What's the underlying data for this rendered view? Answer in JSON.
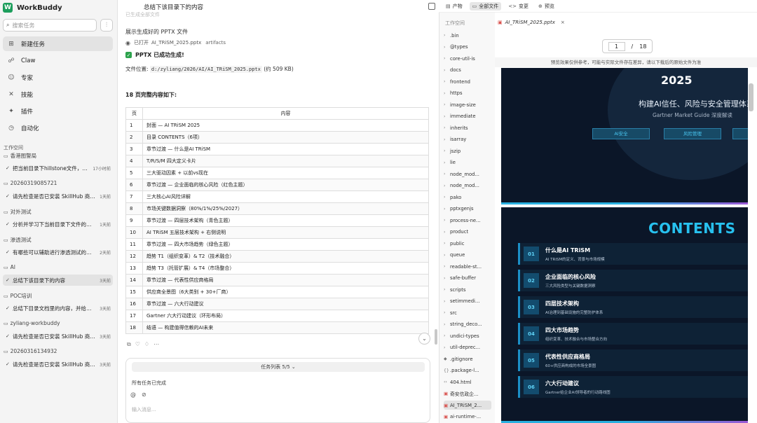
{
  "app": {
    "name": "WorkBuddy",
    "logo_letter": "W"
  },
  "search": {
    "placeholder": "搜索任务"
  },
  "nav": [
    {
      "label": "新建任务",
      "icon": "new-task-icon",
      "glyph": "⊞"
    },
    {
      "label": "Claw",
      "icon": "claw-icon",
      "glyph": "☍"
    },
    {
      "label": "专家",
      "icon": "expert-icon",
      "glyph": "☺"
    },
    {
      "label": "技能",
      "icon": "skill-icon",
      "glyph": "✕"
    },
    {
      "label": "插件",
      "icon": "plugin-icon",
      "glyph": "✦"
    },
    {
      "label": "自动化",
      "icon": "clock-icon",
      "glyph": "◷"
    }
  ],
  "workspace_label": "工作空间",
  "groups": [
    {
      "name": "香港图警局",
      "task": "把当前目录下hillstone文件，…",
      "time": "17小时前"
    },
    {
      "name": "20260319085721",
      "task": "请先检查是否已安装 SkillHub 商…",
      "time": "1天前"
    },
    {
      "name": "对外测试",
      "task": "分析并学习下当前目录下文件的…",
      "time": "1天前"
    },
    {
      "name": "渗透测试",
      "task": "有哪些可以辅助进行渗透测试的…",
      "time": "2天前"
    },
    {
      "name": "AI",
      "task": "总结下该目录下的内容",
      "time": "3天前"
    },
    {
      "name": "POC培训",
      "task": "总结下目录文档里的内容，并给…",
      "time": "3天前"
    },
    {
      "name": "zyliang-workbuddy",
      "task": "请先检查是否已安装 SkillHub 商…",
      "time": "3天前"
    },
    {
      "name": "20260316134932",
      "task": "请先检查是否已安装 SkillHub 商…",
      "time": "3天前"
    }
  ],
  "chat": {
    "title": "总结下该目录下的内容",
    "top_fragment": "已生成全部文件",
    "ppt_heading": "展示生成好的 PPTX 文件",
    "opened_label": "已打开",
    "opened_file": "AI_TRiSM_2025.pptx",
    "opened_dir": "artifacts",
    "success": "PPTX 已成功生成!",
    "file_loc_label": "文件位置:",
    "file_loc_path": "d:/zyliang/2026/AI/AI_TRiSM_2025.pptx",
    "file_loc_size": "(约 509 KB)",
    "pages_intro": "18 页完整内容如下:",
    "table_headers": [
      "页",
      "内容"
    ],
    "table_rows": [
      [
        "1",
        "封面 — AI TRiSM 2025"
      ],
      [
        "2",
        "目录 CONTENTS（6项）"
      ],
      [
        "3",
        "章节过渡 — 什么是AI TRiSM"
      ],
      [
        "4",
        "T/R/S/M 四大定义卡片"
      ],
      [
        "5",
        "三大驱动因素 + 以前vs现在"
      ],
      [
        "6",
        "章节过渡 — 企业面临的核心风险（红色主题）"
      ],
      [
        "7",
        "三大核心AI风险详解"
      ],
      [
        "8",
        "市场关键数据洞察（80%/1%/25%/2027）"
      ],
      [
        "9",
        "章节过渡 — 四层技术架构（青色主题）"
      ],
      [
        "10",
        "AI TRiSM 五层技术架构 + 右侧说明"
      ],
      [
        "11",
        "章节过渡 — 四大市场趋势（绿色主题）"
      ],
      [
        "12",
        "趋势 T1（组织变革）& T2（技术融合）"
      ],
      [
        "13",
        "趋势 T3（托管扩展）& T4（市场整合）"
      ],
      [
        "14",
        "章节过渡 — 代表性供应商格局"
      ],
      [
        "15",
        "供应商全景图（6大类别 + 30+厂商）"
      ],
      [
        "16",
        "章节过渡 — 六大行动建议"
      ],
      [
        "17",
        "Gartner 六大行动建议（环形布局）"
      ],
      [
        "18",
        "结语 — 构建值得信赖的AI未来"
      ]
    ],
    "task_list": "任务列表 5/5",
    "tasks_done": "所有任务已完成",
    "input_placeholder": "输入消息..."
  },
  "top_tabs": [
    {
      "label": "产物",
      "icon": "artifact-icon",
      "glyph": "▤"
    },
    {
      "label": "全部文件",
      "icon": "folder-icon",
      "glyph": "▭"
    },
    {
      "label": "变更",
      "icon": "code-icon",
      "glyph": "<>"
    },
    {
      "label": "预览",
      "icon": "globe-icon",
      "glyph": "⊕"
    }
  ],
  "file_tree": {
    "title": "工作空间",
    "items": [
      ".bin",
      "@types",
      "core-util-is",
      "docs",
      "frontend",
      "https",
      "image-size",
      "immediate",
      "inherits",
      "isarray",
      "jszip",
      "lie",
      "node_mod...",
      "node_mod...",
      "pako",
      "pptxgenjs",
      "process-ne...",
      "product",
      "public",
      "queue",
      "readable-st...",
      "safe-buffer",
      "scripts",
      "setimmedi...",
      "src",
      "string_deco...",
      "undici-types",
      "util-deprec...",
      ".gitignore",
      ".package-l...",
      "404.html",
      "奇安信政企...",
      "AI_TRiSM_2...",
      "ai-runtime-..."
    ]
  },
  "preview": {
    "file_tab": "AI_TRiSM_2025.pptx",
    "page_current": "1",
    "page_sep": "/",
    "page_total": "18",
    "note": "预览效果仅供参考，可能与实际文件存在差异，请以下载后的原始文件为准",
    "slide1": {
      "year": "2025",
      "title": "构建AI信任、风险与安全管理体系",
      "subtitle": "Gartner Market Guide 深度解读",
      "buttons": [
        "AI安全",
        "风险管理"
      ]
    },
    "slide2": {
      "title": "CONTENTS",
      "items": [
        {
          "num": "01",
          "title": "什么是AI TRiSM",
          "sub": "AI TRiSM的定义、背景与市场规模"
        },
        {
          "num": "02",
          "title": "企业面临的核心风险",
          "sub": "三大风险类型与关键数据洞察"
        },
        {
          "num": "03",
          "title": "四层技术架构",
          "sub": "AI治理到基础设施的完整防护体系"
        },
        {
          "num": "04",
          "title": "四大市场趋势",
          "sub": "组织变革、技术融合与市场整合方向"
        },
        {
          "num": "05",
          "title": "代表性供应商格局",
          "sub": "60+供应商构成的市场全景图"
        },
        {
          "num": "06",
          "title": "六大行动建议",
          "sub": "Gartner给企业AI领导者的行动路线图"
        }
      ]
    }
  }
}
